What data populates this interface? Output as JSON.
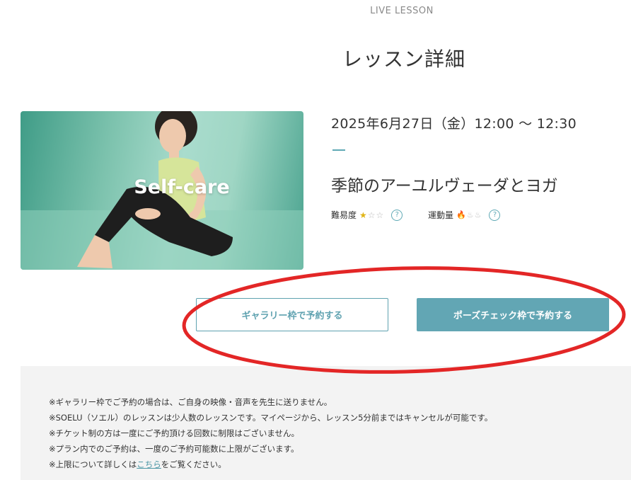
{
  "header": {
    "eyebrow": "LIVE LESSON",
    "title": "レッスン詳細"
  },
  "lesson": {
    "thumbnail_label": "Self-care",
    "datetime": "2025年6月27日（金）12:00 〜 12:30",
    "title": "季節のアーユルヴェーダとヨガ",
    "difficulty_label": "難易度",
    "difficulty_rating": 1,
    "difficulty_max": 3,
    "exercise_label": "運動量",
    "exercise_rating": 1,
    "exercise_max": 3,
    "help_glyph": "?"
  },
  "actions": {
    "gallery_button": "ギャラリー枠で予約する",
    "pose_check_button": "ポーズチェック枠で予約する"
  },
  "notes": {
    "line1": "※ギャラリー枠でご予約の場合は、ご自身の映像・音声を先生に送りません。",
    "line2": "※SOELU（ソエル）のレッスンは少人数のレッスンです。マイページから、レッスン5分前まではキャンセルが可能です。",
    "line3": "※チケット制の方は一度にご予約頂ける回数に制限はございません。",
    "line4": "※プラン内でのご予約は、一度のご予約可能数に上限がございます。",
    "line5_prefix": "※上限について詳しくは",
    "line5_link": "こちら",
    "line5_suffix": "をご覧ください。"
  },
  "colors": {
    "accent": "#5fa9b5",
    "primary_button": "#62a6b4",
    "annotation": "#e32626"
  },
  "icons": [
    "star-icon",
    "flame-icon",
    "help-icon"
  ]
}
